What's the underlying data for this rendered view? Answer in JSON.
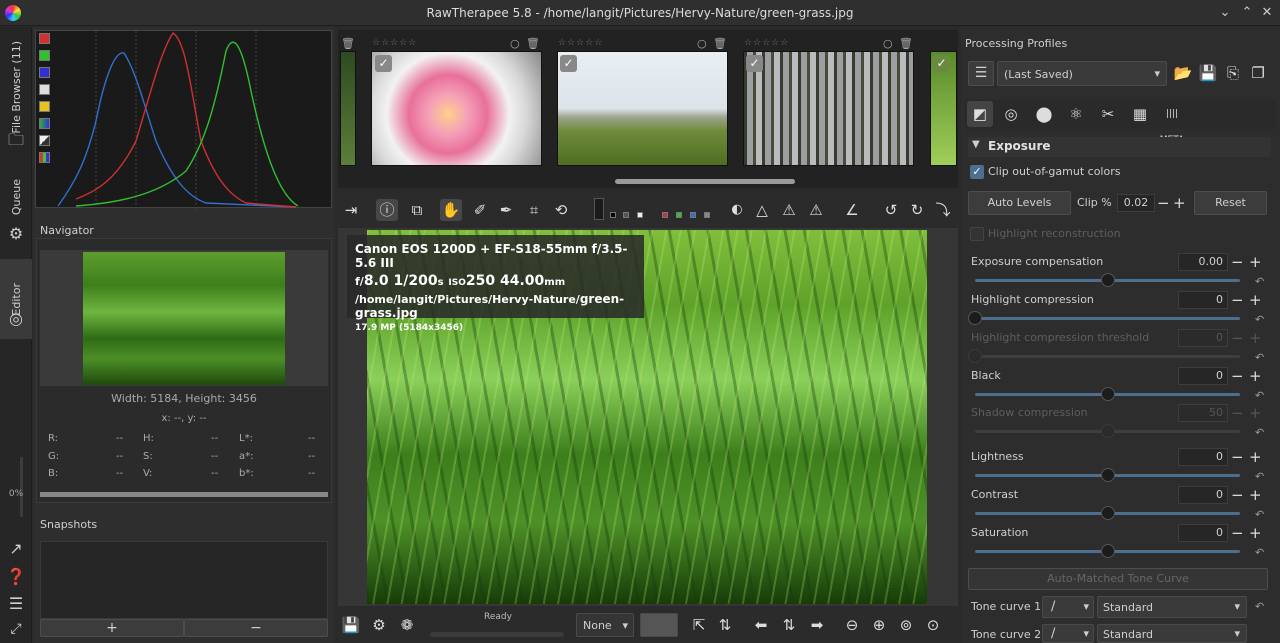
{
  "window": {
    "title": "RawTherapee 5.8 - /home/langit/Pictures/Hervy-Nature/green-grass.jpg"
  },
  "vtabs": {
    "file_browser": "File Browser (11)",
    "queue": "Queue",
    "editor": "Editor",
    "progress": "0%"
  },
  "navigator": {
    "title": "Navigator",
    "dims": "Width: 5184, Height: 3456",
    "xy": "x: --, y: --",
    "rows": [
      {
        "l1": "R:",
        "v1": "--",
        "l2": "H:",
        "v2": "--",
        "l3": "L*:",
        "v3": "--"
      },
      {
        "l1": "G:",
        "v1": "--",
        "l2": "S:",
        "v2": "--",
        "l3": "a*:",
        "v3": "--"
      },
      {
        "l1": "B:",
        "v1": "--",
        "l2": "V:",
        "v2": "--",
        "l3": "b*:",
        "v3": "--"
      }
    ]
  },
  "snapshots": {
    "title": "Snapshots",
    "add": "+",
    "remove": "−"
  },
  "filmstrip": {
    "stars": "☆☆☆☆☆"
  },
  "exif": {
    "camera": "Canon EOS 1200D + EF-S18-55mm f/3.5-5.6 III",
    "aperture_prefix": "f/",
    "aperture": "8.0",
    "shutter": "1/200",
    "shutter_unit": "s",
    "iso_prefix": "ISO",
    "iso": "250",
    "focal": "44.00",
    "focal_unit": "mm",
    "path": "/home/langit/Pictures/Hervy-Nature/",
    "file": "green-grass.jpg",
    "mp": "17.9 MP (5184x3456)"
  },
  "statusbar": {
    "status": "Ready",
    "zoom_select": "None"
  },
  "profiles": {
    "title": "Processing Profiles",
    "current": "(Last Saved)"
  },
  "exposure": {
    "header": "Exposure",
    "clip_gamut": "Clip out-of-gamut colors",
    "auto_levels": "Auto Levels",
    "clip_label": "Clip %",
    "clip_value": "0.02",
    "reset": "Reset",
    "highlight_recon": "Highlight reconstruction",
    "sliders": [
      {
        "label": "Exposure compensation",
        "value": "0.00",
        "pos": 0.5,
        "dim": false
      },
      {
        "label": "Highlight compression",
        "value": "0",
        "pos": 0.0,
        "dim": false
      },
      {
        "label": "Highlight compression threshold",
        "value": "0",
        "pos": 0.0,
        "dim": true
      },
      {
        "label": "Black",
        "value": "0",
        "pos": 0.5,
        "dim": false
      },
      {
        "label": "Shadow compression",
        "value": "50",
        "pos": 0.5,
        "dim": true
      },
      {
        "label": "Lightness",
        "value": "0",
        "pos": 0.5,
        "dim": false
      },
      {
        "label": "Contrast",
        "value": "0",
        "pos": 0.5,
        "dim": false
      },
      {
        "label": "Saturation",
        "value": "0",
        "pos": 0.5,
        "dim": false
      }
    ],
    "auto_matched": "Auto-Matched Tone Curve",
    "tone_curve_1": {
      "label": "Tone curve 1:",
      "mode": "Standard"
    },
    "tone_curve_2": {
      "label": "Tone curve 2:",
      "mode": "Standard"
    }
  },
  "colors": {
    "accent": "#4c6e8f",
    "red": "#d03030",
    "green": "#30c030",
    "blue": "#3070d0"
  }
}
